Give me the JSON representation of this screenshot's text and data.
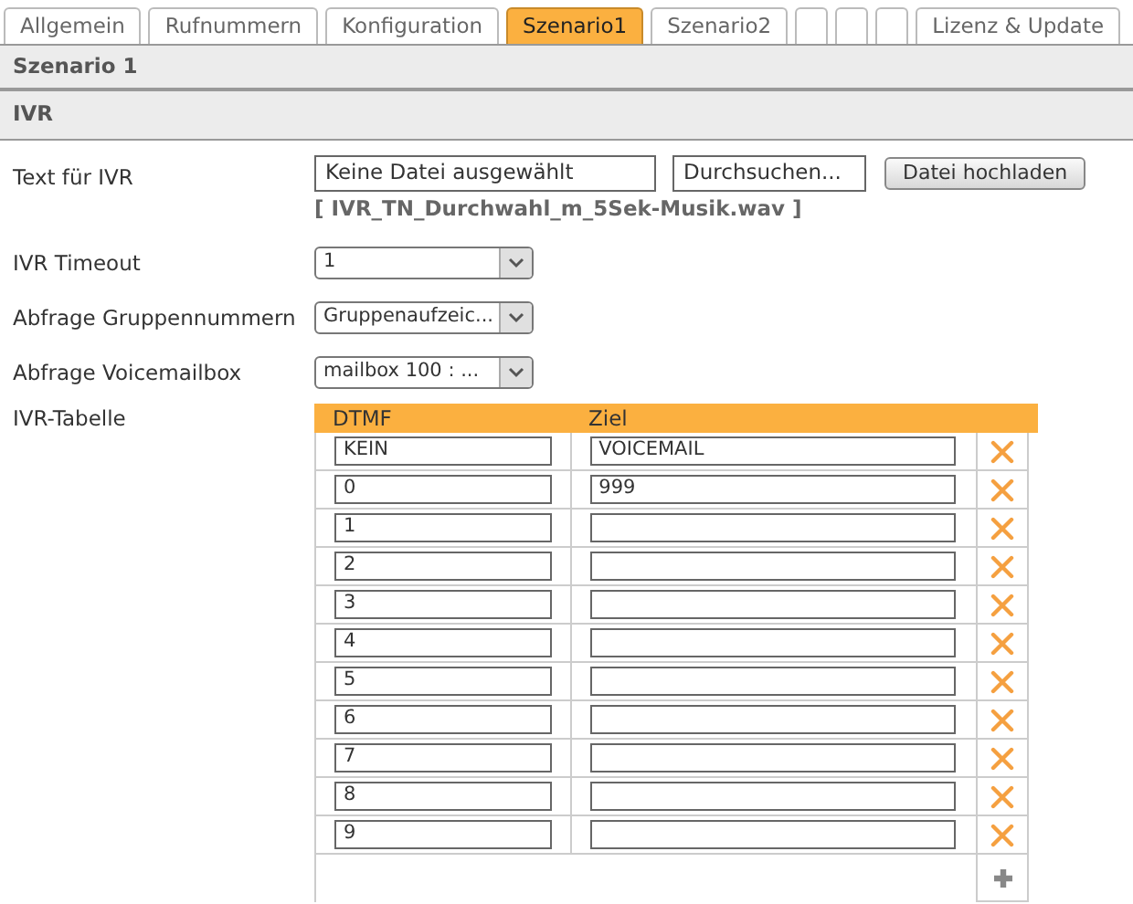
{
  "tabs": [
    {
      "label": "Allgemein",
      "selected": false
    },
    {
      "label": "Rufnummern",
      "selected": false
    },
    {
      "label": "Konfiguration",
      "selected": false
    },
    {
      "label": "Szenario1",
      "selected": true
    },
    {
      "label": "Szenario2",
      "selected": false
    },
    {
      "selected": false
    },
    {
      "selected": false
    },
    {
      "selected": false
    },
    {
      "label": "Lizenz & Update",
      "selected": false
    }
  ],
  "section_title": "Szenario 1",
  "subsection_title": "IVR",
  "form": {
    "text_label": "Text für IVR",
    "file_field": "Keine Datei ausgewählt",
    "browse_button": "Durchsuchen...",
    "upload_button": "Datei hochladen",
    "current_file": "[ IVR_TN_Durchwahl_m_5Sek-Musik.wav ]",
    "selects": [
      {
        "label": "IVR Timeout",
        "value": "1"
      },
      {
        "label": "Abfrage Gruppennummern",
        "value": "Gruppenaufzeic..."
      },
      {
        "label": "Abfrage Voicemailbox",
        "value": "mailbox 100 : ..."
      }
    ]
  },
  "ivr_table": {
    "label": "IVR-Tabelle",
    "columns": [
      "DTMF",
      "Ziel"
    ],
    "rows": [
      {
        "dtmf": "KEIN",
        "target": "VOICEMAIL"
      },
      {
        "dtmf": "0",
        "target": "999"
      },
      {
        "dtmf": "1"
      },
      {
        "dtmf": "2"
      },
      {
        "dtmf": "3"
      },
      {
        "dtmf": "4"
      },
      {
        "dtmf": "5"
      },
      {
        "dtmf": "6"
      },
      {
        "dtmf": "7"
      },
      {
        "dtmf": "8"
      },
      {
        "dtmf": "9"
      }
    ]
  }
}
